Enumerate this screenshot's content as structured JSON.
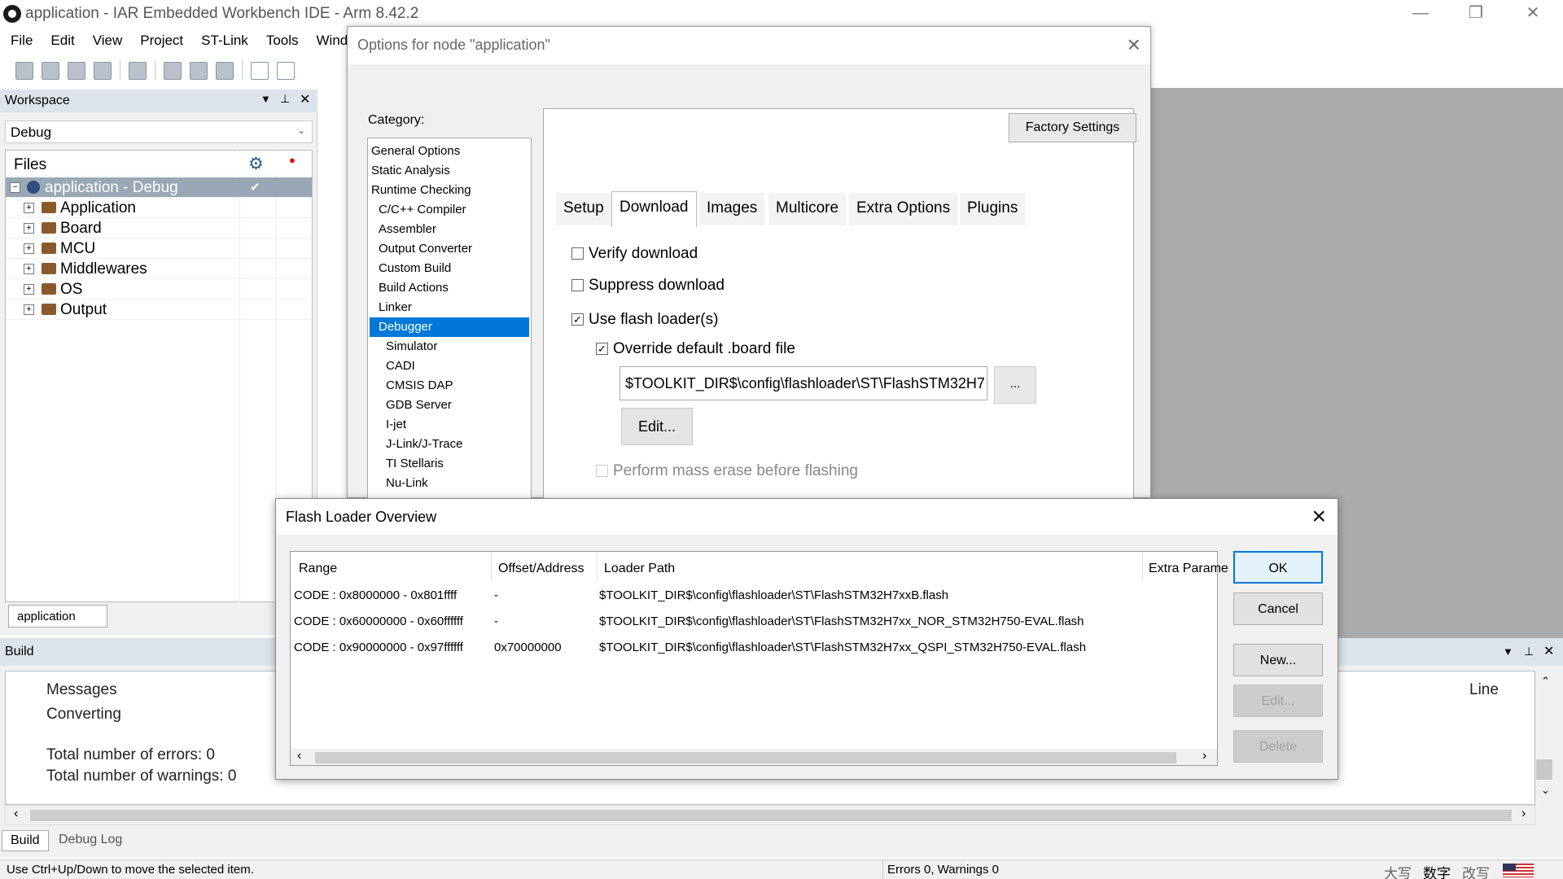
{
  "window": {
    "title": "application - IAR Embedded Workbench IDE - Arm 8.42.2"
  },
  "menubar": [
    "File",
    "Edit",
    "View",
    "Project",
    "ST-Link",
    "Tools",
    "Wind"
  ],
  "workspace": {
    "header": "Workspace",
    "config": "Debug",
    "files_header": "Files",
    "root": "application - Debug",
    "items": [
      "Application",
      "Board",
      "MCU",
      "Middlewares",
      "OS",
      "Output"
    ],
    "tab": "application"
  },
  "build": {
    "header": "Build",
    "messages_col": "Messages",
    "line_col": "Line",
    "lines": [
      "Converting",
      "Total number of errors: 0",
      "Total number of warnings: 0"
    ],
    "tabs": [
      "Build",
      "Debug Log"
    ]
  },
  "status": {
    "left": "Use Ctrl+Up/Down to move the selected item.",
    "mid": "Errors 0, Warnings 0",
    "ime": [
      "大写",
      "数字",
      "改写"
    ]
  },
  "options": {
    "title": "Options for node \"application\"",
    "category_label": "Category:",
    "categories": [
      "General Options",
      "Static Analysis",
      "Runtime Checking",
      "C/C++ Compiler",
      "Assembler",
      "Output Converter",
      "Custom Build",
      "Build Actions",
      "Linker",
      "Debugger",
      "Simulator",
      "CADI",
      "CMSIS DAP",
      "GDB Server",
      "I-jet",
      "J-Link/J-Trace",
      "TI Stellaris",
      "Nu-Link"
    ],
    "factory_settings": "Factory Settings",
    "tabs": [
      "Setup",
      "Download",
      "Images",
      "Multicore",
      "Extra Options",
      "Plugins"
    ],
    "verify": "Verify download",
    "suppress": "Suppress download",
    "use_flash": "Use flash loader(s)",
    "override": "Override default .board file",
    "path": "$TOOLKIT_DIR$\\config\\flashloader\\ST\\FlashSTM32H7",
    "browse": "...",
    "edit": "Edit...",
    "mass_erase": "Perform mass erase before flashing"
  },
  "flash_loader": {
    "title": "Flash Loader Overview",
    "columns": [
      "Range",
      "Offset/Address",
      "Loader Path",
      "Extra Parame"
    ],
    "rows": [
      {
        "range": "CODE : 0x8000000 - 0x801ffff",
        "offset": "-",
        "path": "$TOOLKIT_DIR$\\config\\flashloader\\ST\\FlashSTM32H7xxB.flash"
      },
      {
        "range": "CODE : 0x60000000 - 0x60ffffff",
        "offset": "-",
        "path": "$TOOLKIT_DIR$\\config\\flashloader\\ST\\FlashSTM32H7xx_NOR_STM32H750-EVAL.flash"
      },
      {
        "range": "CODE : 0x90000000 - 0x97ffffff",
        "offset": "0x70000000",
        "path": "$TOOLKIT_DIR$\\config\\flashloader\\ST\\FlashSTM32H7xx_QSPI_STM32H750-EVAL.flash"
      }
    ],
    "buttons": {
      "ok": "OK",
      "cancel": "Cancel",
      "new": "New...",
      "edit": "Edit...",
      "delete": "Delete"
    }
  }
}
